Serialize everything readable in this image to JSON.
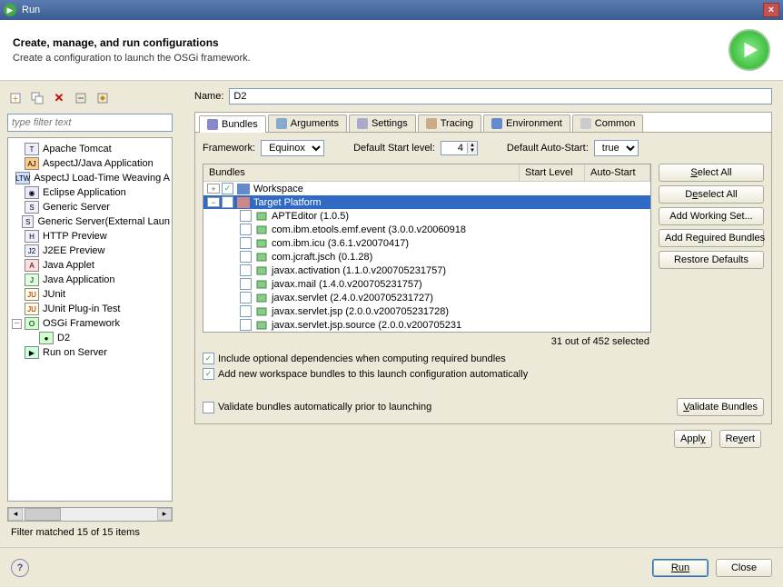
{
  "window": {
    "title": "Run"
  },
  "header": {
    "title": "Create, manage, and run configurations",
    "subtitle": "Create a configuration to launch the OSGi framework."
  },
  "sidebar": {
    "filter_placeholder": "type filter text",
    "items": [
      {
        "label": "Apache Tomcat"
      },
      {
        "label": "AspectJ/Java Application"
      },
      {
        "label": "AspectJ Load-Time Weaving A"
      },
      {
        "label": "Eclipse Application"
      },
      {
        "label": "Generic Server"
      },
      {
        "label": "Generic Server(External Laun"
      },
      {
        "label": "HTTP Preview"
      },
      {
        "label": "J2EE Preview"
      },
      {
        "label": "Java Applet"
      },
      {
        "label": "Java Application"
      },
      {
        "label": "JUnit"
      },
      {
        "label": "JUnit Plug-in Test"
      },
      {
        "label": "OSGi Framework",
        "expanded": true
      },
      {
        "label": "D2",
        "child": true
      },
      {
        "label": "Run on Server"
      }
    ],
    "status": "Filter matched 15 of 15 items"
  },
  "main": {
    "name_label": "Name:",
    "name_value": "D2",
    "tabs": [
      "Bundles",
      "Arguments",
      "Settings",
      "Tracing",
      "Environment",
      "Common"
    ],
    "active_tab": 0,
    "framework_label": "Framework:",
    "framework_value": "Equinox",
    "default_start_label": "Default Start level:",
    "default_start_value": "4",
    "default_auto_label": "Default Auto-Start:",
    "default_auto_value": "true",
    "table": {
      "columns": [
        "Bundles",
        "Start Level",
        "Auto-Start"
      ],
      "groups": [
        {
          "label": "Workspace",
          "checked": true,
          "expanded": true
        },
        {
          "label": "Target Platform",
          "checked": false,
          "expanded": true,
          "selected": true
        }
      ],
      "rows": [
        {
          "label": "APTEditor (1.0.5)"
        },
        {
          "label": "com.ibm.etools.emf.event (3.0.0.v20060918"
        },
        {
          "label": "com.ibm.icu (3.6.1.v20070417)"
        },
        {
          "label": "com.jcraft.jsch (0.1.28)"
        },
        {
          "label": "javax.activation (1.1.0.v200705231757)"
        },
        {
          "label": "javax.mail (1.4.0.v200705231757)"
        },
        {
          "label": "javax.servlet (2.4.0.v200705231727)"
        },
        {
          "label": "javax.servlet.jsp (2.0.0.v200705231728)"
        },
        {
          "label": "javax.servlet.jsp.source (2.0.0.v200705231"
        }
      ],
      "count": "31 out of 452 selected"
    },
    "side_buttons": {
      "select_all": "Select All",
      "deselect_all": "Deselect All",
      "add_working": "Add Working Set...",
      "add_required": "Add Required Bundles",
      "restore": "Restore Defaults"
    },
    "check_include": "Include optional dependencies when computing required bundles",
    "check_addnew": "Add new workspace bundles to this launch configuration automatically",
    "check_validate": "Validate bundles automatically prior to launching",
    "validate_btn": "Validate Bundles",
    "apply": "Apply",
    "revert": "Revert"
  },
  "footer": {
    "run": "Run",
    "close": "Close"
  }
}
